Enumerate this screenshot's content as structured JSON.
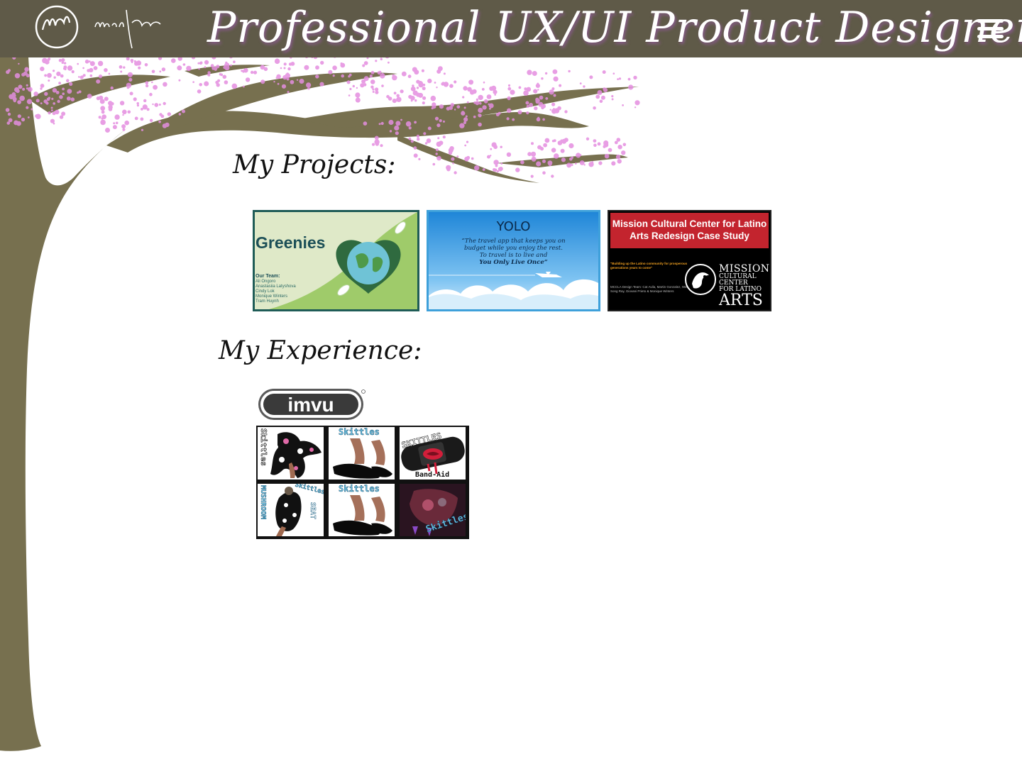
{
  "header": {
    "title": "Professional UX/UI Product Designer",
    "logo_label": "Monique Winters",
    "menu_icon": "hamburger-menu-icon",
    "background_color": "#5f5a48"
  },
  "projects": {
    "heading": "My Projects:",
    "items": [
      {
        "name": "Greenies",
        "team_heading": "Our Team:",
        "team": [
          "Ali Ongoro",
          "Anastasiia Latyshova",
          "Cindy Lok",
          "Monique Winters",
          "Tram Huynh"
        ]
      },
      {
        "name": "YOLO",
        "tagline_lines": [
          "“The travel app that keeps you on",
          "budget while you enjoy the rest.",
          "To travel is to live and",
          "You Only Live Once”"
        ]
      },
      {
        "name": "Mission Cultural Center for Latino Arts  Redesign Case Study",
        "quote": "\"Building up the Latino community for prosperous generations years to come\"",
        "team": "MCCLA Design Team: Cat Avila, Martin Gonzalez, Wei Song Ray, Giovani Prieto & Monique Winters",
        "logo_lines": [
          "MISSION",
          "CULTURAL CENTER",
          "FOR LATINO",
          "ARTS"
        ]
      }
    ]
  },
  "experience": {
    "heading": "My Experience:",
    "company_logo": "imvu",
    "gallery": [
      "Skittles",
      "Skittles",
      "SKITTLES",
      "Band-Aid",
      "MUSHROOM",
      "SEAT",
      "Skittles",
      "Skittles",
      "Skittles"
    ]
  },
  "colors": {
    "tree_trunk": "#77704f",
    "blossom": "#e48ee0"
  }
}
